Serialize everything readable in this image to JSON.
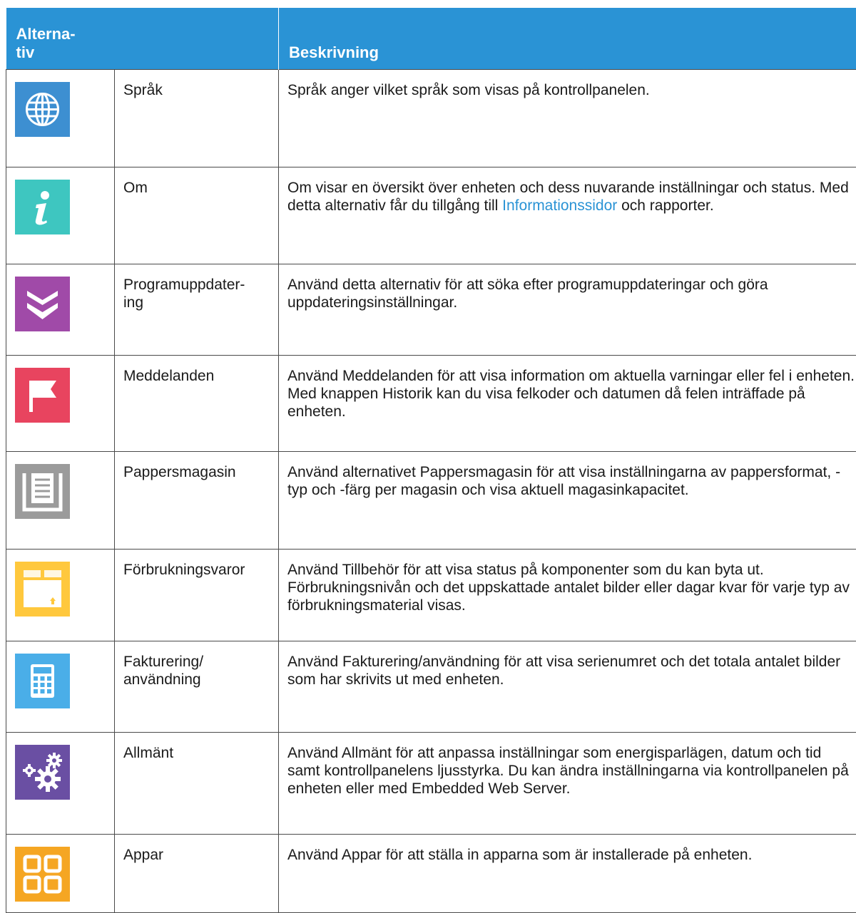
{
  "table": {
    "header": {
      "alt_line1": "Alterna-",
      "alt_line2": "tiv",
      "desc": "Beskrivning"
    },
    "rows": [
      {
        "name": "Språk",
        "icon": "globe-icon",
        "color": "#3d8fd1",
        "desc": "Språk anger vilket språk som visas på kontrollpanelen."
      },
      {
        "name": "Om",
        "icon": "info-icon",
        "color": "#3ec6c0",
        "desc_pre": "Om visar en översikt över enheten och dess nuvarande inställningar och status. Med detta alternativ får du tillgång till ",
        "desc_link": "Informationssidor",
        "desc_post": " och rapporter."
      },
      {
        "name": "Programuppdatering",
        "name_line1": "Programuppdater-",
        "name_line2": "ing",
        "icon": "download-chevron-icon",
        "color": "#a04aa8",
        "desc": "Använd detta alternativ för att söka efter programuppdateringar och göra uppdateringsinställningar."
      },
      {
        "name": "Meddelanden",
        "icon": "flag-icon",
        "color": "#e8445f",
        "desc": "Använd Meddelanden för att visa information om aktuella varningar eller fel i enheten. Med knappen Historik kan du visa felkoder och datumen då felen inträffade på enheten."
      },
      {
        "name": "Pappersmagasin",
        "icon": "paper-tray-icon",
        "color": "#9b9b9b",
        "desc": "Använd alternativet Pappersmagasin för att visa inställningarna av pappersformat, - typ och -färg per magasin och visa aktuell magasinkapacitet."
      },
      {
        "name": "Förbrukningsvaror",
        "icon": "supplies-box-icon",
        "color": "#ffc83d",
        "desc": "Använd Tillbehör för att visa status på komponenter som du kan byta ut. Förbrukningsnivån och det uppskattade antalet bilder eller dagar kvar för varje typ av förbrukningsmaterial visas."
      },
      {
        "name_line1": "Fakturering/",
        "name_line2": "användning",
        "icon": "calculator-icon",
        "color": "#4aaee8",
        "desc": "Använd Fakturering/användning för att visa serienumret och det totala antalet bilder som har skrivits ut med enheten."
      },
      {
        "name": "Allmänt",
        "icon": "gears-icon",
        "color": "#6a4fa3",
        "desc": "Använd Allmänt för att anpassa inställningar som energisparlägen, datum och tid samt kontrollpanelens ljusstyrka. Du kan ändra inställningarna via kontrollpanelen på enheten eller med Embedded Web Server."
      },
      {
        "name": "Appar",
        "icon": "apps-grid-icon",
        "color": "#f5a623",
        "desc": "Använd Appar för att ställa in apparna som är installerade på enheten."
      }
    ]
  }
}
